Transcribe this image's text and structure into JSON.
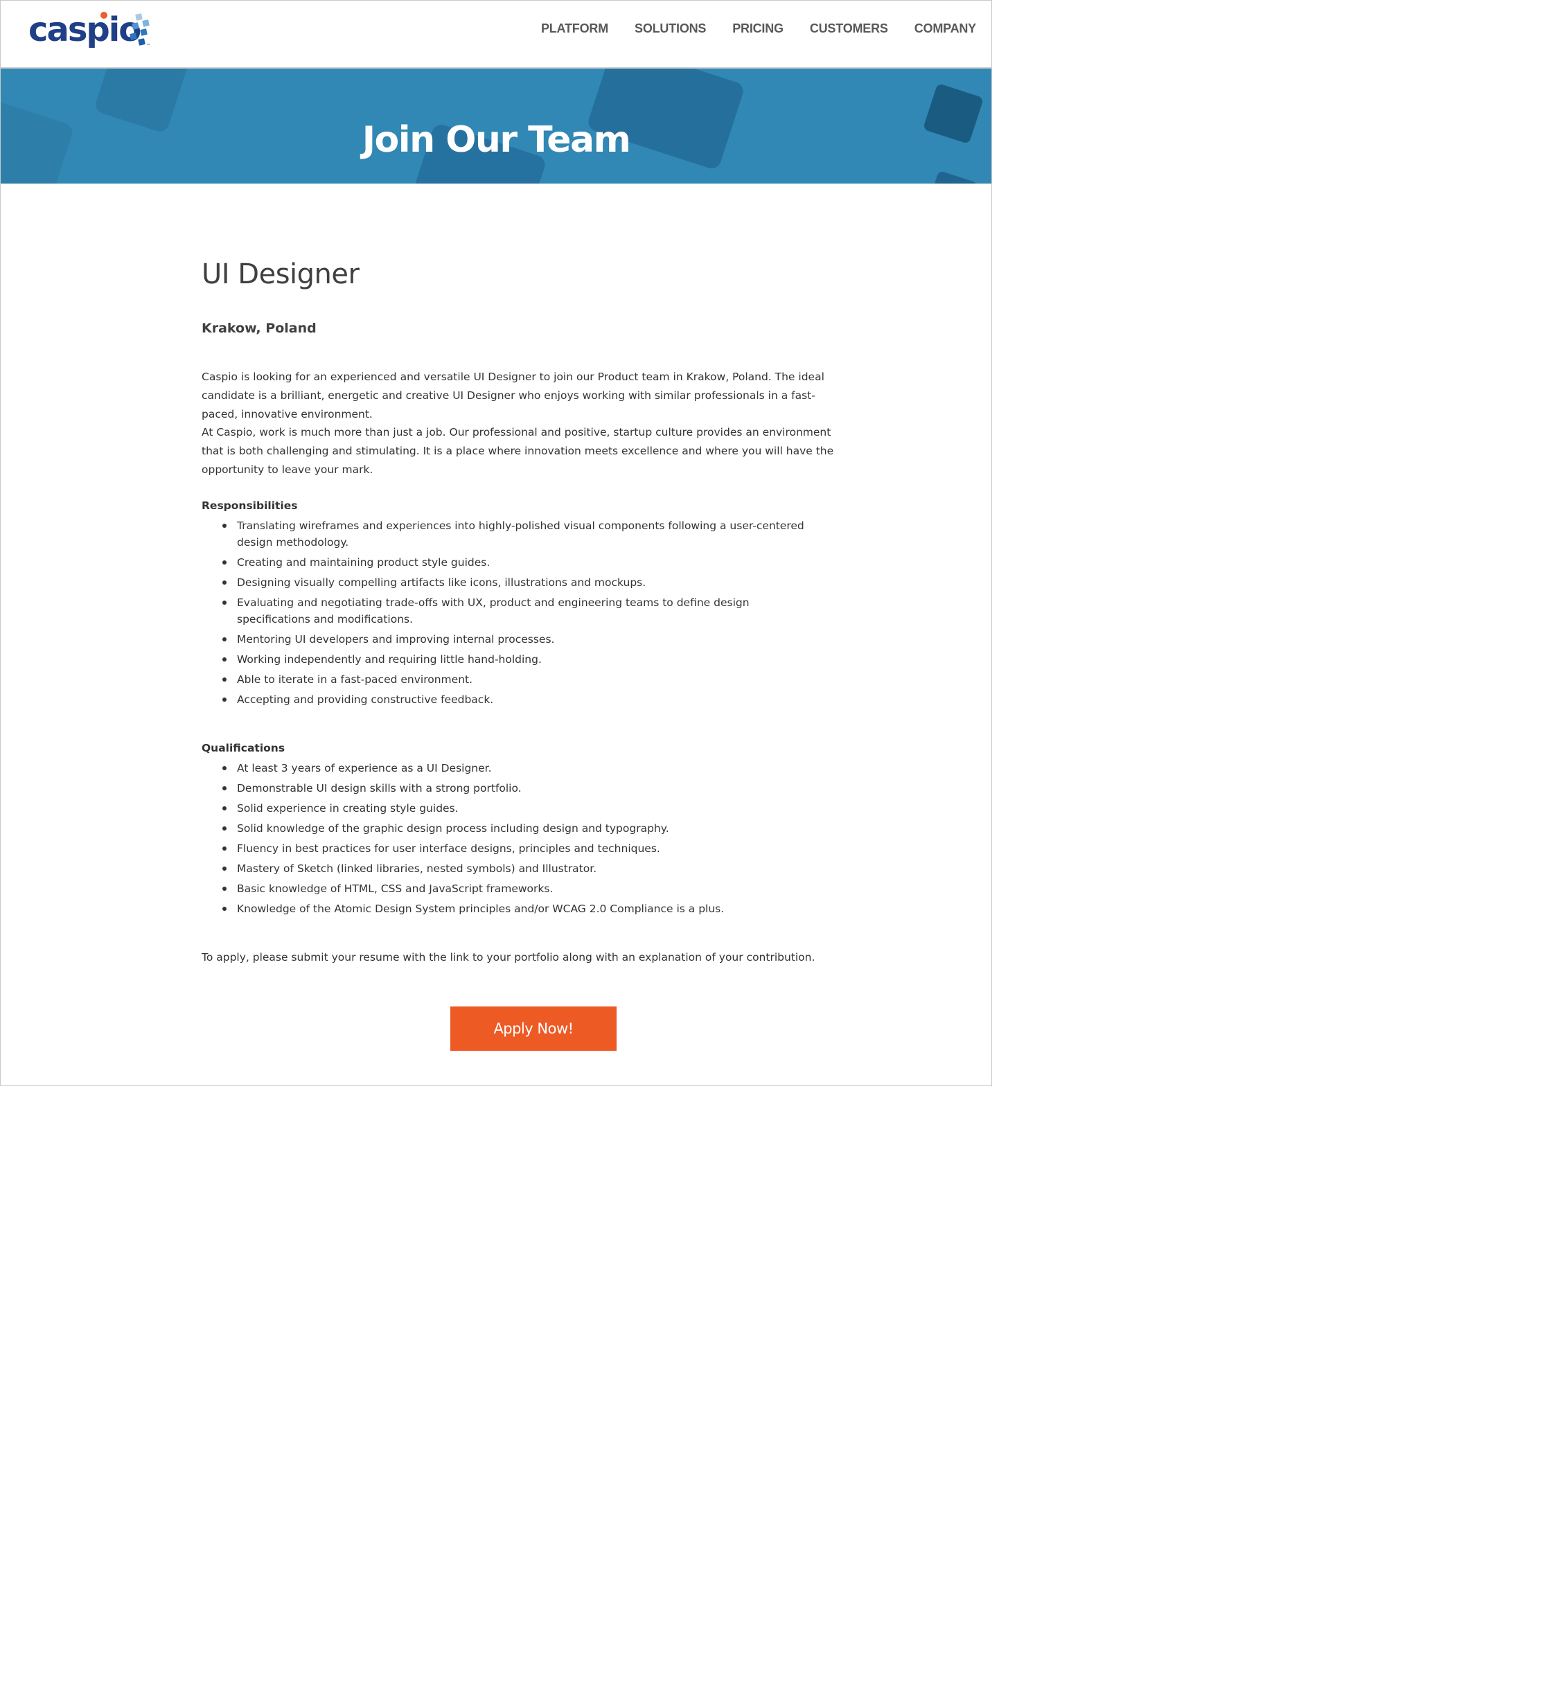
{
  "brand": {
    "logo_text": "caspio",
    "tm": "™"
  },
  "nav": [
    "PLATFORM",
    "SOLUTIONS",
    "PRICING",
    "CUSTOMERS",
    "COMPANY"
  ],
  "hero": {
    "title": "Join Our Team"
  },
  "job": {
    "title": "UI Designer",
    "location": "Krakow, Poland",
    "intro": [
      "Caspio is looking for an experienced and versatile UI Designer to join our Product team in Krakow, Poland. The ideal candidate is a brilliant, energetic and creative UI Designer who enjoys working with similar professionals in a fast-paced, innovative environment.",
      "At Caspio, work is much more than just a job. Our professional and positive, startup culture provides an environment that is both challenging and stimulating. It is a place where innovation meets excellence and where you will have the opportunity to leave your mark."
    ],
    "responsibilities": {
      "heading": "Responsibilities",
      "items": [
        "Translating wireframes and experiences into highly-polished visual components following a user-centered design methodology.",
        "Creating and maintaining product style guides.",
        "Designing visually compelling artifacts like icons, illustrations and mockups.",
        "Evaluating and negotiating trade-offs with UX, product and engineering teams to define design specifications and modifications.",
        "Mentoring UI developers and improving internal processes.",
        "Working independently and requiring little hand-holding.",
        "Able to iterate in a fast-paced environment.",
        "Accepting and providing constructive feedback."
      ]
    },
    "qualifications": {
      "heading": "Qualifications",
      "items": [
        "At least 3 years of experience as a UI Designer.",
        "Demonstrable UI design skills with a strong portfolio.",
        "Solid experience in creating style guides.",
        "Solid knowledge of the graphic design process including design and typography.",
        "Fluency in best practices for user interface designs, principles and techniques.",
        "Mastery of Sketch (linked libraries, nested symbols) and Illustrator.",
        "Basic knowledge of HTML, CSS and JavaScript frameworks.",
        "Knowledge of the Atomic Design System principles and/or WCAG 2.0 Compliance is a plus."
      ]
    },
    "apply_note": "To apply, please submit your resume with the link to your portfolio along with an explanation of your contribution.",
    "apply_button": "Apply Now!"
  },
  "colors": {
    "brand_blue": "#1f3f86",
    "hero_blue": "#3188b4",
    "accent_orange": "#ee5a24"
  }
}
